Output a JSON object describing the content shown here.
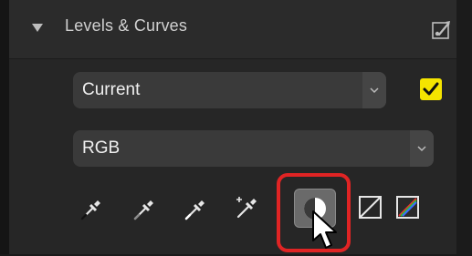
{
  "panel": {
    "title": "Levels & Curves",
    "collapse_icon": "triangle-down-icon",
    "tool_icon": "auto-adjust-brush-icon"
  },
  "preset_select": {
    "value": "Current",
    "checkbox_checked": true
  },
  "channel_select": {
    "value": "RGB"
  },
  "tools": [
    {
      "name": "black-point-eyedropper-icon"
    },
    {
      "name": "gray-point-eyedropper-icon"
    },
    {
      "name": "white-point-eyedropper-icon"
    },
    {
      "name": "neutral-point-eyedropper-icon"
    },
    {
      "name": "auto-contrast-icon",
      "active": true
    },
    {
      "name": "reset-curve-icon"
    },
    {
      "name": "channel-colors-icon"
    }
  ],
  "colors": {
    "checkbox": "#f5e400",
    "highlight": "#e02424"
  }
}
